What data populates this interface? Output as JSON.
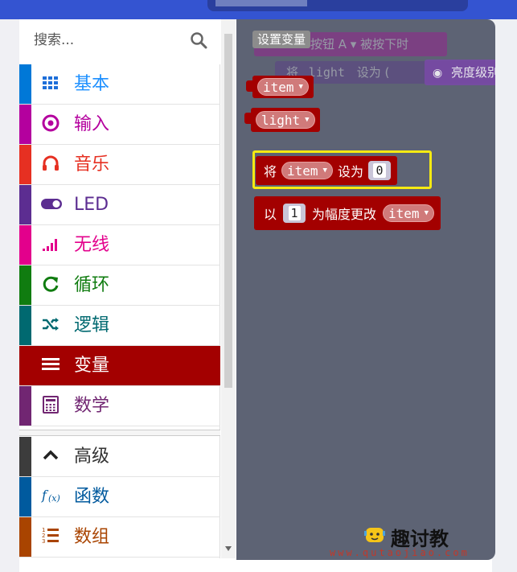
{
  "search": {
    "placeholder": "搜索..."
  },
  "categories": [
    {
      "label": "基本",
      "icon": "grid-icon",
      "color": "#1e90ff",
      "stripe": "#0078d7"
    },
    {
      "label": "输入",
      "icon": "target-icon",
      "color": "#b4009e",
      "stripe": "#b4009e"
    },
    {
      "label": "音乐",
      "icon": "headphones-icon",
      "color": "#e63022",
      "stripe": "#e63022"
    },
    {
      "label": "LED",
      "icon": "toggle-icon",
      "color": "#5c2d91",
      "stripe": "#5c2d91"
    },
    {
      "label": "无线",
      "icon": "signal-bars-icon",
      "color": "#e3008c",
      "stripe": "#e3008c"
    },
    {
      "label": "循环",
      "icon": "refresh-icon",
      "color": "#107c10",
      "stripe": "#107c10"
    },
    {
      "label": "逻辑",
      "icon": "shuffle-icon",
      "color": "#006970",
      "stripe": "#006970"
    },
    {
      "label": "变量",
      "icon": "list-lines-icon",
      "color": "#ffffff",
      "stripe": "#a30000",
      "selected": true
    },
    {
      "label": "数学",
      "icon": "calculator-icon",
      "color": "#712672",
      "stripe": "#712672"
    }
  ],
  "advanced": [
    {
      "label": "高级",
      "icon": "chevron-up-icon",
      "color": "#333333",
      "stripe": "#3c3c3c"
    },
    {
      "label": "函数",
      "icon": "function-icon",
      "color": "#005a9e",
      "stripe": "#005a9e"
    },
    {
      "label": "数组",
      "icon": "numbered-list-icon",
      "color": "#a94400",
      "stripe": "#a94400"
    }
  ],
  "flyout": {
    "heading": "设置变量",
    "ghost": {
      "row1": "按钮 A ▾ 被按下时",
      "row2_prefix": "将",
      "row2_var": "light",
      "row2_mid": "设为 (",
      "row2_tail": "亮度级别"
    },
    "var_items": [
      "item",
      "light"
    ],
    "set_block": {
      "prefix": "将",
      "var": "item",
      "mid": "设为",
      "value": "0"
    },
    "change_block": {
      "prefix": "以",
      "value": "1",
      "mid": "为幅度更改",
      "var": "item"
    }
  },
  "watermark": {
    "brand": "趣讨教",
    "url": "www.qutaojiao.com"
  }
}
